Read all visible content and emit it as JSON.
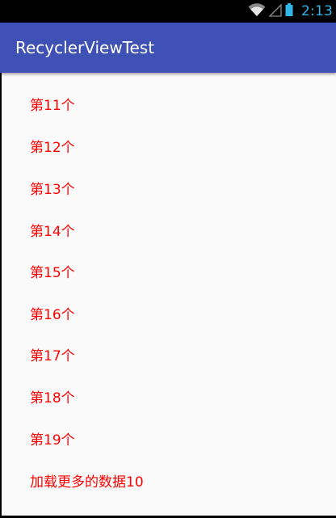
{
  "status_bar": {
    "time": "2:13",
    "icons": [
      "wifi-icon",
      "signal-icon",
      "battery-icon"
    ],
    "time_color": "#33b5e5"
  },
  "app_bar": {
    "title": "RecyclerViewTest",
    "color": "#3f51b5"
  },
  "list": {
    "text_color": "#ff0000",
    "items": [
      "第11个",
      "第12个",
      "第13个",
      "第14个",
      "第15个",
      "第16个",
      "第17个",
      "第18个",
      "第19个"
    ],
    "footer": "加载更多的数据10"
  }
}
